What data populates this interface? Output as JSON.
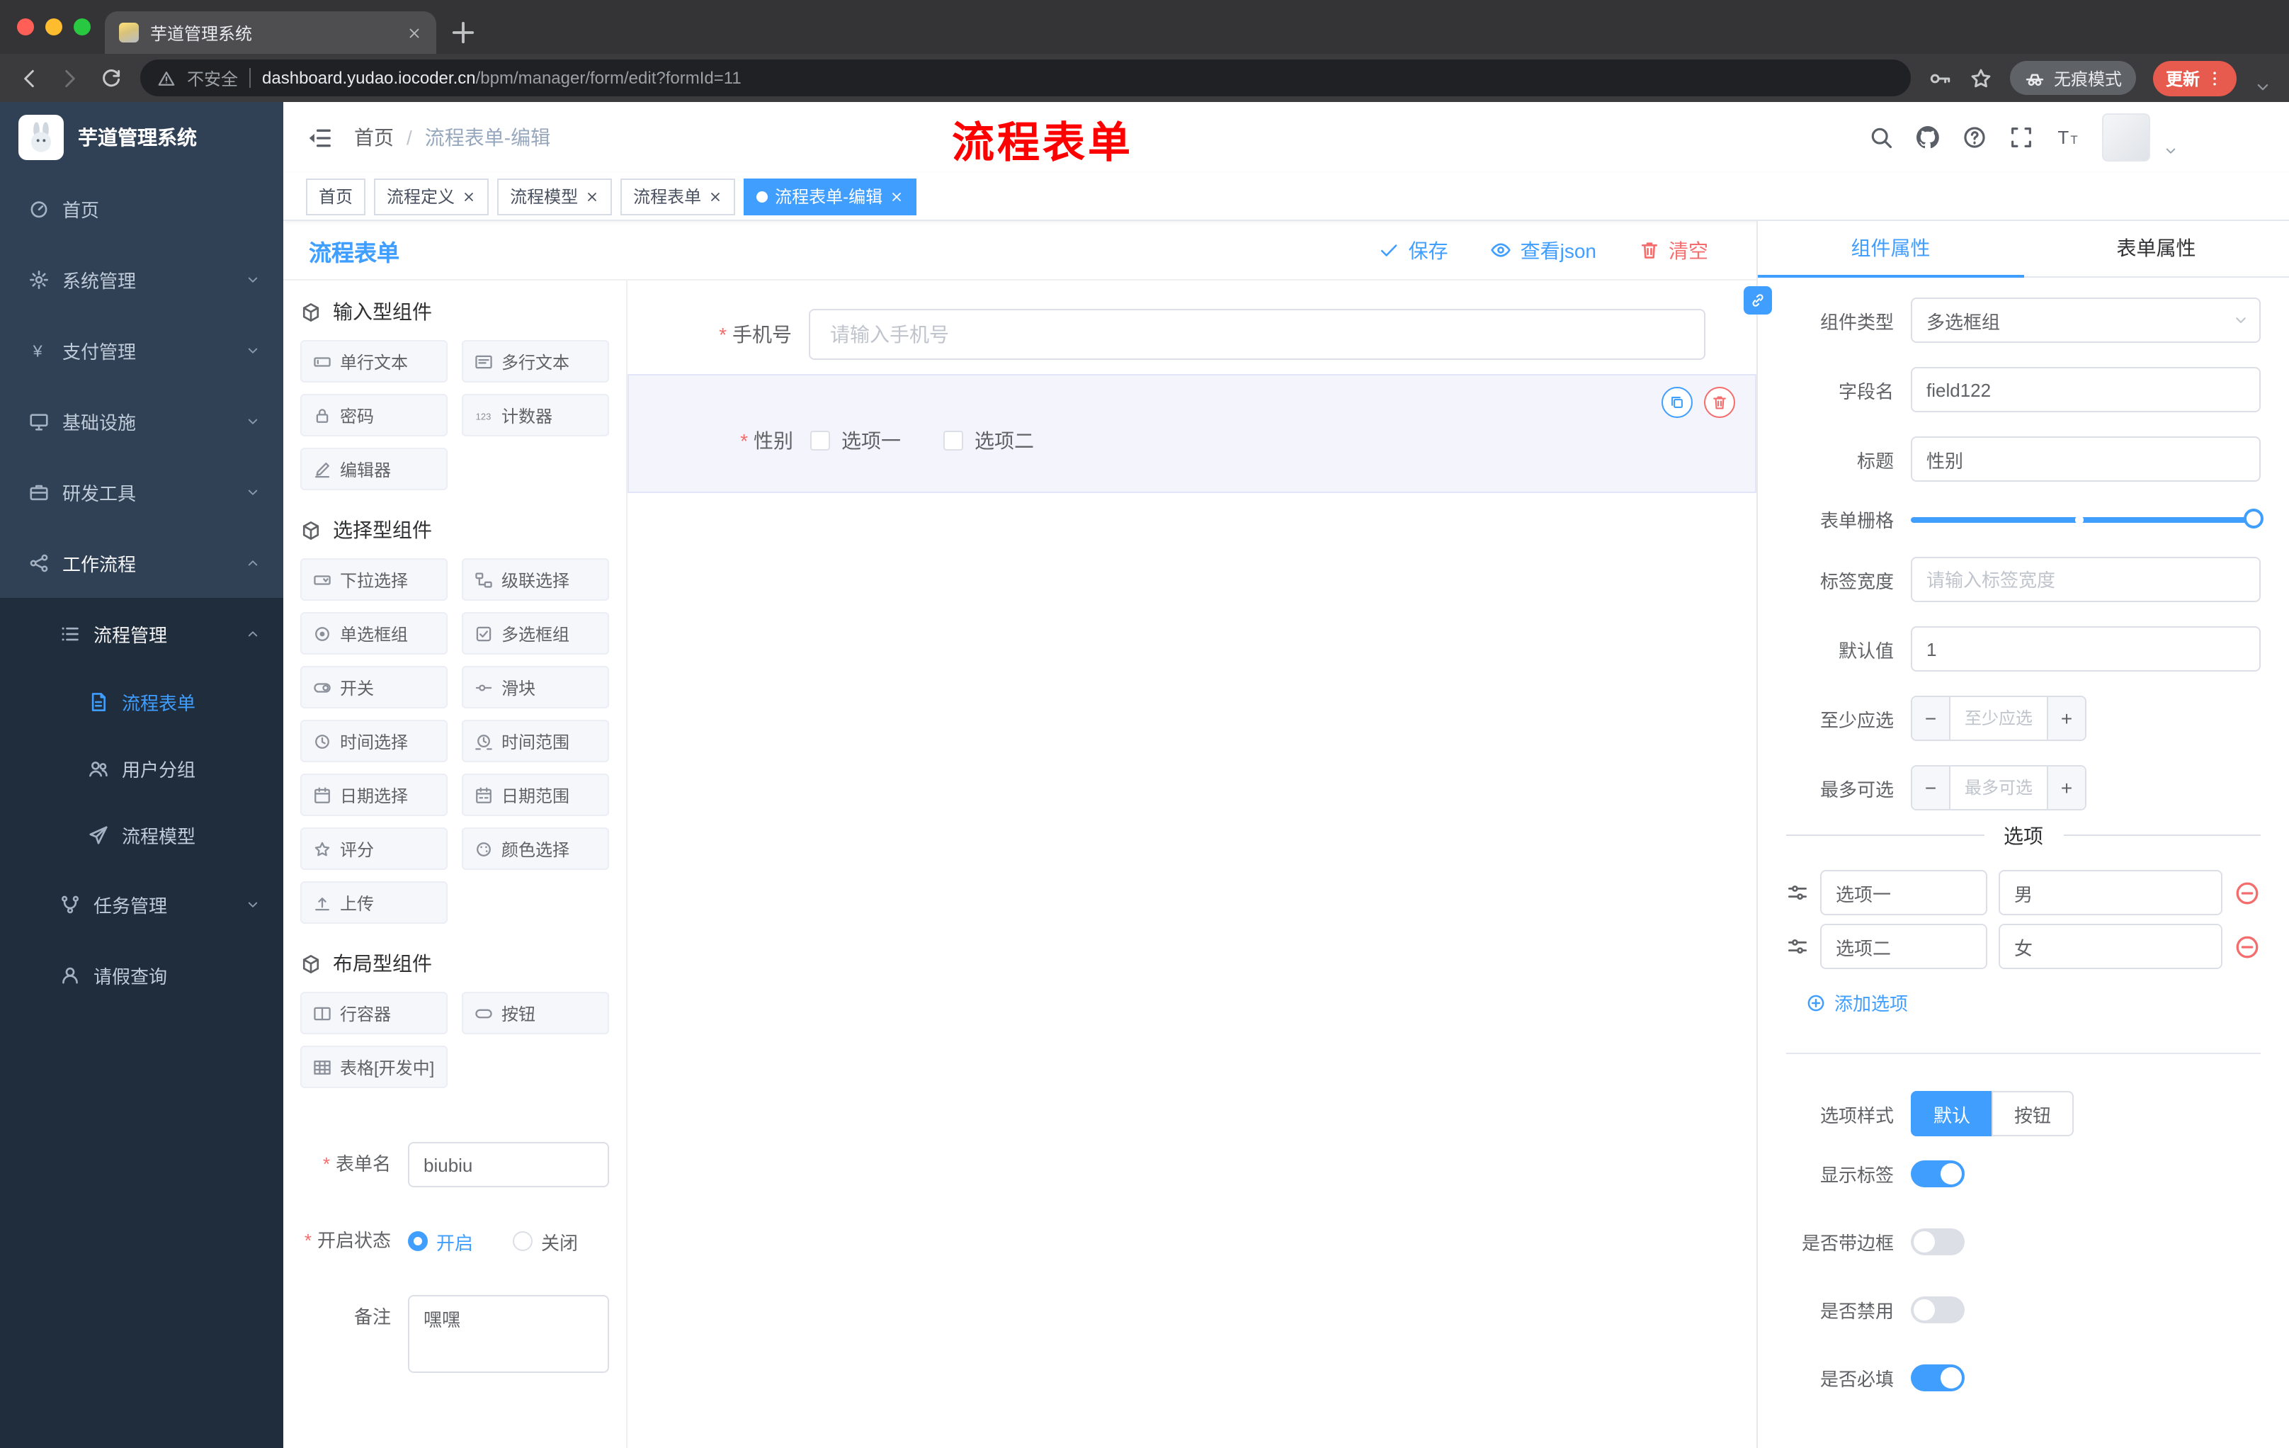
{
  "colors": {
    "accent": "#409eff",
    "danger": "#f56c6c",
    "annotation_red": "#ff0000",
    "sidebar_bg": "#304156",
    "sidebar_submenu_bg": "#1f2d3d",
    "update_badge": "#e65b4e"
  },
  "browser": {
    "tab_title": "芋道管理系统",
    "security_label": "不安全",
    "url_domain": "dashboard.yudao.iocoder.cn",
    "url_path": "/bpm/manager/form/edit?formId=11",
    "incognito_label": "无痕模式",
    "update_label": "更新"
  },
  "sidebar": {
    "logo_title": "芋道管理系统",
    "items": [
      {
        "label": "首页",
        "icon": "dashboard",
        "level": 1
      },
      {
        "label": "系统管理",
        "icon": "gear",
        "level": 1,
        "chevron": "down"
      },
      {
        "label": "支付管理",
        "icon": "yen",
        "level": 1,
        "chevron": "down"
      },
      {
        "label": "基础设施",
        "icon": "monitor",
        "level": 1,
        "chevron": "down"
      },
      {
        "label": "研发工具",
        "icon": "briefcase",
        "level": 1,
        "chevron": "down"
      },
      {
        "label": "工作流程",
        "icon": "flow",
        "level": 1,
        "chevron": "up",
        "open": true
      },
      {
        "label": "流程管理",
        "icon": "list",
        "level": 2,
        "chevron": "up",
        "open": true
      },
      {
        "label": "流程表单",
        "icon": "doc",
        "level": 3,
        "active": true
      },
      {
        "label": "用户分组",
        "icon": "users",
        "level": 3
      },
      {
        "label": "流程模型",
        "icon": "send",
        "level": 3
      },
      {
        "label": "任务管理",
        "icon": "tasks",
        "level": 2,
        "chevron": "down"
      },
      {
        "label": "请假查询",
        "icon": "user",
        "level": 2
      }
    ]
  },
  "header": {
    "breadcrumb": [
      "首页",
      "流程表单-编辑"
    ],
    "breadcrumb_separator": "/",
    "annotation": "流程表单"
  },
  "tags": [
    {
      "label": "首页",
      "closable": false,
      "active": false
    },
    {
      "label": "流程定义",
      "closable": true,
      "active": false
    },
    {
      "label": "流程模型",
      "closable": true,
      "active": false
    },
    {
      "label": "流程表单",
      "closable": true,
      "active": false
    },
    {
      "label": "流程表单-编辑",
      "closable": true,
      "active": true
    }
  ],
  "designer": {
    "title": "流程表单",
    "save_label": "保存",
    "view_json_label": "查看json",
    "clear_label": "清空"
  },
  "palette": {
    "sections": [
      {
        "title": "输入型组件",
        "items": [
          {
            "label": "单行文本",
            "icon": "input"
          },
          {
            "label": "多行文本",
            "ic": "",
            "icon": "textarea"
          },
          {
            "label": "密码",
            "icon": "password"
          },
          {
            "label": "计数器",
            "icon": "counter"
          },
          {
            "label": "编辑器",
            "icon": "editor"
          }
        ]
      },
      {
        "title": "选择型组件",
        "items": [
          {
            "label": "下拉选择",
            "icon": "select"
          },
          {
            "label": "级联选择",
            "icon": "cascader"
          },
          {
            "label": "单选框组",
            "icon": "radio-group"
          },
          {
            "label": "多选框组",
            "icon": "checkbox-group"
          },
          {
            "label": "开关",
            "icon": "switch"
          },
          {
            "label": "滑块",
            "icon": "slider"
          },
          {
            "label": "时间选择",
            "icon": "time"
          },
          {
            "label": "时间范围",
            "icon": "time-range"
          },
          {
            "label": "日期选择",
            "icon": "date"
          },
          {
            "label": "日期范围",
            "icon": "date-range"
          },
          {
            "label": "评分",
            "icon": "rate"
          },
          {
            "label": "颜色选择",
            "icon": "color"
          },
          {
            "label": "上传",
            "icon": "upload"
          }
        ]
      },
      {
        "title": "布局型组件",
        "items": [
          {
            "label": "行容器",
            "icon": "row-container"
          },
          {
            "label": "按钮",
            "icon": "button"
          },
          {
            "label": "表格[开发中]",
            "icon": "table"
          }
        ]
      }
    ]
  },
  "meta": {
    "form_name_label": "表单名",
    "form_name_value": "biubiu",
    "status_label": "开启状态",
    "status_on": "开启",
    "status_off": "关闭",
    "status_selected": "开启",
    "remark_label": "备注",
    "remark_value": "嘿嘿"
  },
  "canvas": {
    "phone_label": "手机号",
    "phone_placeholder": "请输入手机号",
    "gender_label": "性别",
    "gender_options": [
      "选项一",
      "选项二"
    ]
  },
  "props": {
    "tab_component": "组件属性",
    "tab_form": "表单属性",
    "active_tab": "组件属性",
    "component_type_label": "组件类型",
    "component_type_value": "多选框组",
    "field_name_label": "字段名",
    "field_name_value": "field122",
    "title_label": "标题",
    "title_value": "性别",
    "grid_label": "表单栅格",
    "label_width_label": "标签宽度",
    "label_width_placeholder": "请输入标签宽度",
    "default_label": "默认值",
    "default_value": "1",
    "min_label": "至少应选",
    "min_placeholder": "至少应选",
    "max_label": "最多可选",
    "max_placeholder": "最多可选",
    "options_title": "选项",
    "options": [
      {
        "label": "选项一",
        "value": "男"
      },
      {
        "label": "选项二",
        "value": "女"
      }
    ],
    "add_option_label": "添加选项",
    "option_style_label": "选项样式",
    "styles": [
      {
        "label": "默认",
        "active": true
      },
      {
        "label": "按钮",
        "active": false
      }
    ],
    "toggles": [
      {
        "label": "显示标签",
        "on": true
      },
      {
        "label": "是否带边框",
        "on": false
      },
      {
        "label": "是否禁用",
        "on": false
      },
      {
        "label": "是否必填",
        "on": true
      }
    ]
  }
}
